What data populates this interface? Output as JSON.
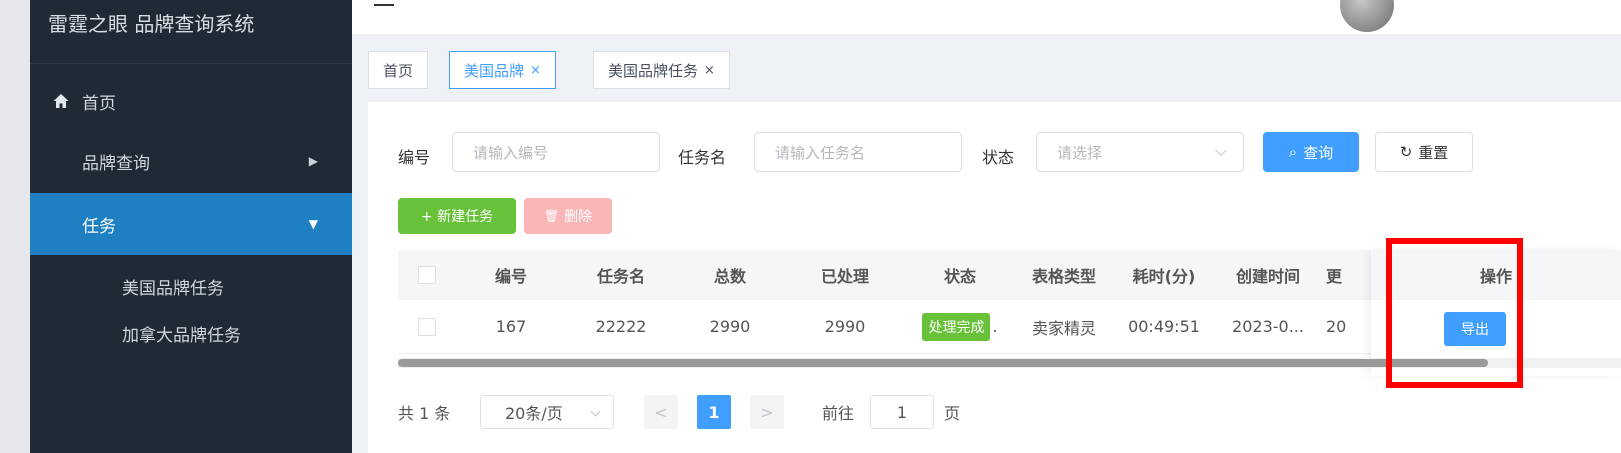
{
  "app": {
    "title": "雷霆之眼 品牌查询系统"
  },
  "sidebar": {
    "items": [
      {
        "label": "首页",
        "icon": "home-icon"
      },
      {
        "label": "品牌查询",
        "icon": "grid-icon",
        "arrow": "▶"
      },
      {
        "label": "任务",
        "icon": "grid-icon",
        "arrow": "▼",
        "active": true
      },
      {
        "label": "美国品牌任务",
        "icon": "grid-icon"
      },
      {
        "label": "加拿大品牌任务",
        "icon": "grid-icon"
      }
    ]
  },
  "tabs": [
    {
      "label": "首页"
    },
    {
      "label": "美国品牌",
      "close": "×",
      "active": true
    },
    {
      "label": "美国品牌任务",
      "close": "×"
    }
  ],
  "filters": {
    "id_label": "编号",
    "id_placeholder": "请输入编号",
    "name_label": "任务名",
    "name_placeholder": "请输入任务名",
    "status_label": "状态",
    "status_placeholder": "请选择",
    "search_label": "查询",
    "search_icon": "⌕",
    "reset_label": "重置",
    "reset_icon": "↻"
  },
  "toolbar": {
    "new_label": "+ 新建任务",
    "delete_label": "删除",
    "delete_icon": "🗑"
  },
  "table": {
    "columns": [
      "编号",
      "任务名",
      "总数",
      "已处理",
      "状态",
      "表格类型",
      "耗时(分)",
      "创建时间",
      "更"
    ],
    "rows": [
      {
        "id": "167",
        "name": "22222",
        "total": "2990",
        "processed": "2990",
        "status": "处理完成",
        "extra": ".",
        "sheet_type": "卖家精灵",
        "duration": "00:49:51",
        "created": "2023-0...",
        "updated": "20"
      }
    ],
    "action_header": "操作",
    "export_label": "导出"
  },
  "pagination": {
    "total_text": "共 1 条",
    "page_size": "20条/页",
    "prev": "<",
    "current": "1",
    "next": ">",
    "goto_label": "前往",
    "goto_value": "1",
    "page_unit": "页"
  },
  "colors": {
    "sidebar_bg": "#1f2a35",
    "active": "#1e7fc3",
    "primary": "#409eff",
    "success": "#67c23a",
    "highlight": "#ff0000"
  }
}
